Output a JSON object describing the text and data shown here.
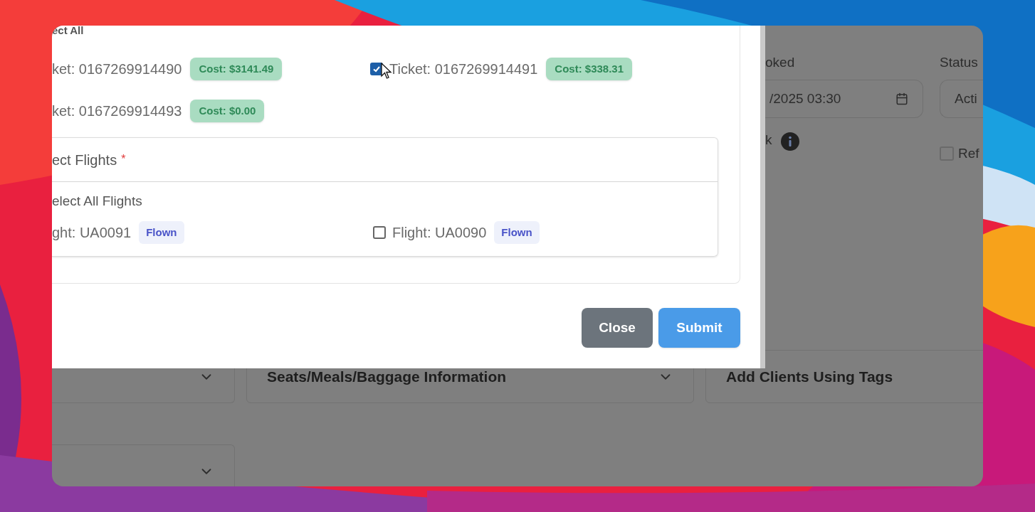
{
  "modal": {
    "select_all_label": "ect All",
    "tickets": [
      {
        "label": "ket: 0167269914490",
        "cost": "Cost: $3141.49"
      },
      {
        "label": "Ticket: 0167269914491",
        "cost": "Cost: $338.31",
        "checked": true
      },
      {
        "label": "ket: 0167269914493",
        "cost": "Cost: $0.00"
      }
    ],
    "flights_panel": {
      "title": "ect Flights",
      "required_mark": "*",
      "select_all_label": "elect All Flights",
      "flights": [
        {
          "label": "ght: UA0091",
          "status": "Flown"
        },
        {
          "label": "Flight: UA0090",
          "status": "Flown",
          "checked": false
        }
      ]
    },
    "buttons": [
      {
        "label": "Close",
        "kind": "secondary"
      },
      {
        "label": "Submit",
        "kind": "primary"
      }
    ]
  },
  "background_form": {
    "booked_label": "oked",
    "booked_value": "/2025 03:30",
    "link_label": "k",
    "status_label": "Status",
    "status_value": "Acti",
    "refund_label": "Ref",
    "refund_checked": false,
    "accordions": [
      {
        "kind": "untitled"
      },
      {
        "kind": "titled",
        "title": "Seats/Meals/Baggage Information"
      },
      {
        "kind": "title_only",
        "title": "Add Clients Using Tags"
      },
      {
        "kind": "untitled"
      }
    ]
  }
}
